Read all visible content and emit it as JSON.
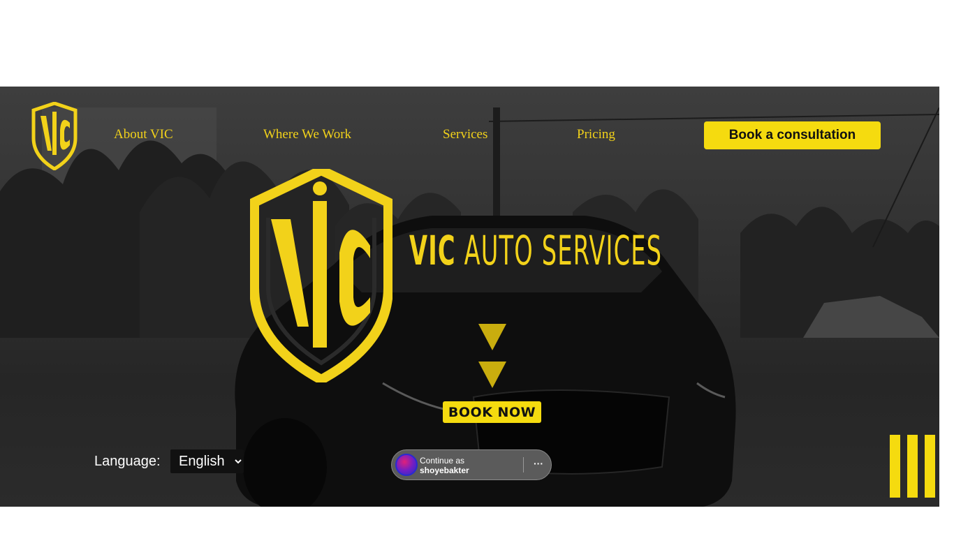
{
  "nav": {
    "links": [
      "About VIC",
      "Where We Work",
      "Services",
      "Pricing"
    ],
    "cta_label": "Book a consultation",
    "logo_icon": "vic-shield-logo"
  },
  "hero": {
    "brand_bold": "VIC",
    "brand_rest": " AUTO SERVICES",
    "book_now_label": "BOOK NOW",
    "scroll_icon": "down-arrow-icon"
  },
  "language": {
    "label": "Language:",
    "selected": "English"
  },
  "continue_as": {
    "line1": "Continue as",
    "username": "shoyebakter",
    "more_label": "···"
  },
  "menu": {
    "icon": "menu-bars-icon"
  },
  "colors": {
    "accent": "#f5db0f",
    "nav_text": "#f2d21a",
    "hero_dark": "#2b2b2b"
  }
}
